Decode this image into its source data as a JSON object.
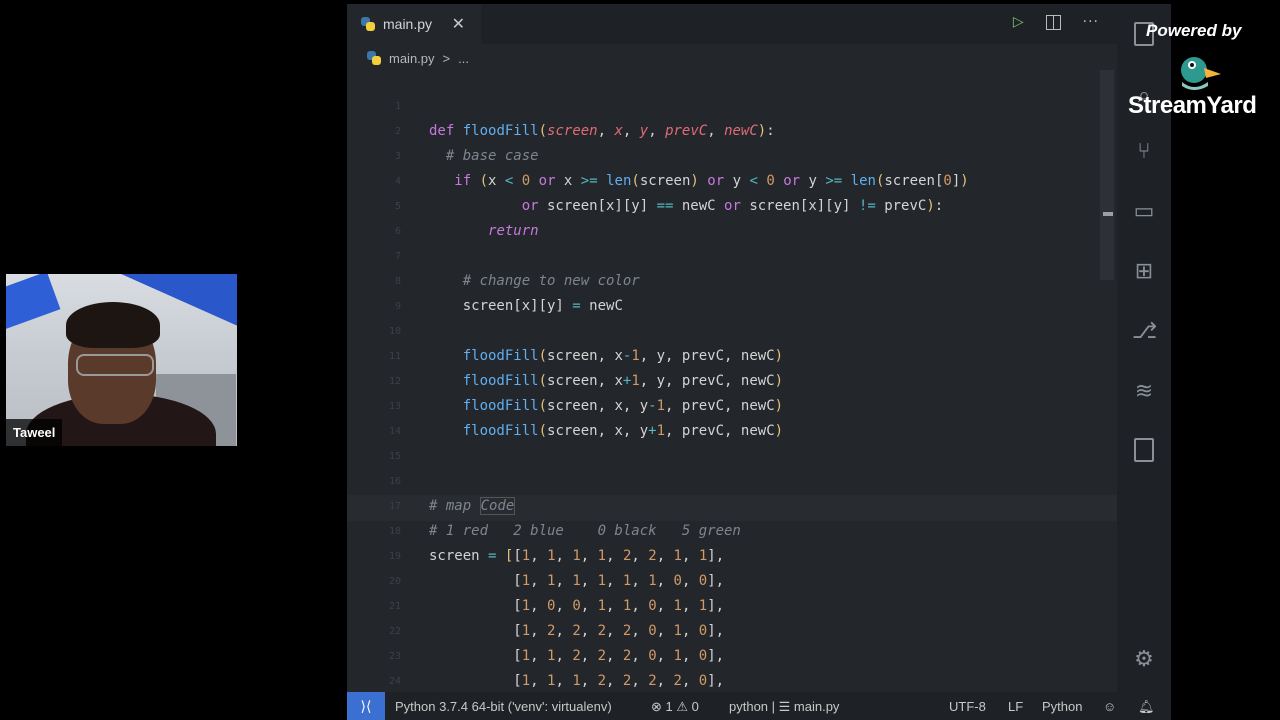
{
  "webcam": {
    "participant_name": "Taweel"
  },
  "streamyard": {
    "powered_by": "Powered by",
    "brand": "StreamYard"
  },
  "editor": {
    "tab": {
      "filename": "main.py",
      "close": "✕"
    },
    "actions": {
      "run": "▷",
      "more": "···"
    },
    "breadcrumb": {
      "file": "main.py",
      "separator": ">",
      "more": "..."
    },
    "code_lines": [
      {
        "num": "1",
        "html": ""
      },
      {
        "num": "2",
        "html": "<span class='kw'>def</span> <span class='fn'>floodFill</span><span class='br'>(</span><span class='par'>screen</span>, <span class='par'>x</span>, <span class='par'>y</span>, <span class='par'>prevC</span>, <span class='par'>newC</span><span class='br'>)</span>:"
      },
      {
        "num": "3",
        "html": "  <span class='cm'># base case</span>"
      },
      {
        "num": "4",
        "html": "   <span class='kw'>if</span> <span class='br'>(</span>x <span class='op'>&lt;</span> <span class='num'>0</span> <span class='kw'>or</span> x <span class='op'>&gt;=</span> <span class='fn'>len</span><span class='br'>(</span>screen<span class='br'>)</span> <span class='kw'>or</span> y <span class='op'>&lt;</span> <span class='num'>0</span> <span class='kw'>or</span> y <span class='op'>&gt;=</span> <span class='fn'>len</span><span class='br'>(</span>screen[<span class='num'>0</span>]<span class='br'>)</span>"
      },
      {
        "num": "5",
        "html": "           <span class='kw'>or</span> screen[x][y] <span class='op'>==</span> newC <span class='kw'>or</span> screen[x][y] <span class='op'>!=</span> prevC<span class='br'>)</span>:"
      },
      {
        "num": "6",
        "html": "       <span class='kw' style='font-style:italic'>return</span>"
      },
      {
        "num": "7",
        "html": ""
      },
      {
        "num": "8",
        "html": "    <span class='cm'># change to new color</span>"
      },
      {
        "num": "9",
        "html": "    screen[x][y] <span class='op'>=</span> newC"
      },
      {
        "num": "10",
        "html": ""
      },
      {
        "num": "11",
        "html": "    <span class='fn'>floodFill</span><span class='br'>(</span>screen, x<span class='op'>-</span><span class='num'>1</span>, y, prevC, newC<span class='br'>)</span>"
      },
      {
        "num": "12",
        "html": "    <span class='fn'>floodFill</span><span class='br'>(</span>screen, x<span class='op'>+</span><span class='num'>1</span>, y, prevC, newC<span class='br'>)</span>"
      },
      {
        "num": "13",
        "html": "    <span class='fn'>floodFill</span><span class='br'>(</span>screen, x, y<span class='op'>-</span><span class='num'>1</span>, prevC, newC<span class='br'>)</span>"
      },
      {
        "num": "14",
        "html": "    <span class='fn'>floodFill</span><span class='br'>(</span>screen, x, y<span class='op'>+</span><span class='num'>1</span>, prevC, newC<span class='br'>)</span>"
      },
      {
        "num": "15",
        "html": ""
      },
      {
        "num": "16",
        "html": ""
      },
      {
        "num": "17",
        "html": "<span class='cm'># map <span class='codeword'>Code</span></span>"
      },
      {
        "num": "18",
        "html": "<span class='cm'># 1 red   2 blue    0 black   5 green</span>"
      },
      {
        "num": "19",
        "html": "screen <span class='op'>=</span> <span class='br'>[</span>[<span class='num'>1</span>, <span class='num'>1</span>, <span class='num'>1</span>, <span class='num'>1</span>, <span class='num'>2</span>, <span class='num'>2</span>, <span class='num'>1</span>, <span class='num'>1</span>],"
      },
      {
        "num": "20",
        "html": "          [<span class='num'>1</span>, <span class='num'>1</span>, <span class='num'>1</span>, <span class='num'>1</span>, <span class='num'>1</span>, <span class='num'>1</span>, <span class='num'>0</span>, <span class='num'>0</span>],"
      },
      {
        "num": "21",
        "html": "          [<span class='num'>1</span>, <span class='num'>0</span>, <span class='num'>0</span>, <span class='num'>1</span>, <span class='num'>1</span>, <span class='num'>0</span>, <span class='num'>1</span>, <span class='num'>1</span>],"
      },
      {
        "num": "22",
        "html": "          [<span class='num'>1</span>, <span class='num'>2</span>, <span class='num'>2</span>, <span class='num'>2</span>, <span class='num'>2</span>, <span class='num'>0</span>, <span class='num'>1</span>, <span class='num'>0</span>],"
      },
      {
        "num": "23",
        "html": "          [<span class='num'>1</span>, <span class='num'>1</span>, <span class='num'>2</span>, <span class='num'>2</span>, <span class='num'>2</span>, <span class='num'>0</span>, <span class='num'>1</span>, <span class='num'>0</span>],"
      },
      {
        "num": "24",
        "html": "          [<span class='num'>1</span>, <span class='num'>1</span>, <span class='num'>1</span>, <span class='num'>2</span>, <span class='num'>2</span>, <span class='num'>2</span>, <span class='num'>2</span>, <span class='num'>0</span>],"
      }
    ],
    "status": {
      "remote": "⟩⟨",
      "interpreter": "Python 3.7.4 64-bit ('venv': virtualenv)",
      "problems": "⊗ 1 ⚠ 0",
      "symbols": "python | ☰ main.py",
      "encoding": "UTF-8",
      "eol": "LF",
      "language": "Python",
      "feedback": "☺",
      "bell": "🔔︎"
    }
  }
}
